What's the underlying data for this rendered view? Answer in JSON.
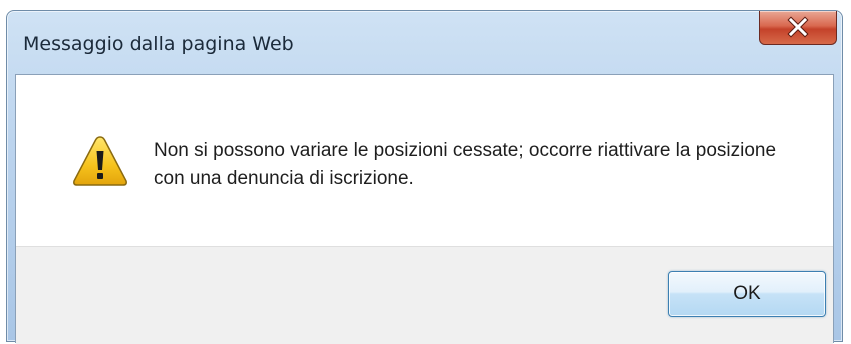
{
  "dialog": {
    "title": "Messaggio dalla pagina Web",
    "message": "Non si possono variare le posizioni cessate; occorre riattivare la posizione con una denuncia di iscrizione.",
    "icon": "warning-icon",
    "ok_label": "OK",
    "close_icon": "close-icon"
  },
  "colors": {
    "close_button": "#c8452d",
    "ok_button_border": "#3c7fb1",
    "warning_yellow": "#f6c21c",
    "button_area_bg": "#f0f0f0",
    "titlebar": "#bcd4ee"
  }
}
